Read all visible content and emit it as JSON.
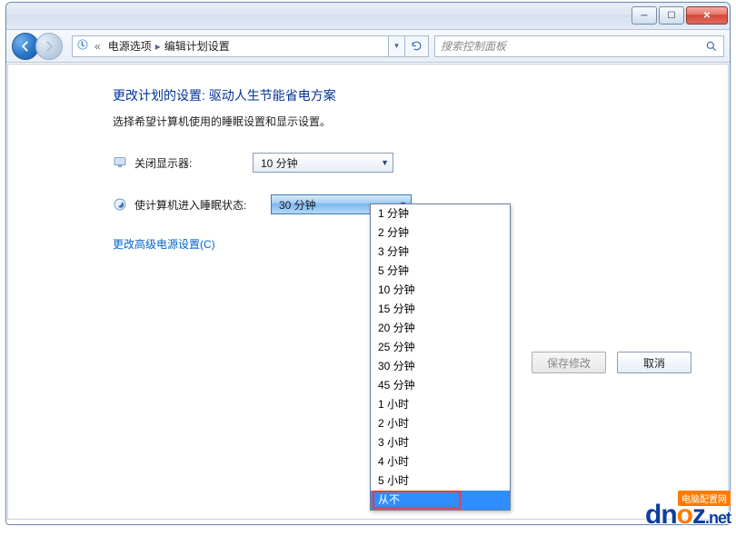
{
  "window_buttons": {
    "min": "─",
    "max": "☐",
    "close": "✕"
  },
  "breadcrumb": {
    "icon_label": "power-options-icon",
    "prefix": "«",
    "seg1": "电源选项",
    "seg2": "编辑计划设置"
  },
  "search": {
    "placeholder": "搜索控制面板"
  },
  "heading": "更改计划的设置: 驱动人生节能省电方案",
  "subtext": "选择希望计算机使用的睡眠设置和显示设置。",
  "rows": {
    "display": {
      "label": "关闭显示器:",
      "value": "10 分钟"
    },
    "sleep": {
      "label": "使计算机进入睡眠状态:",
      "value": "30 分钟"
    }
  },
  "advanced_link": "更改高级电源设置(C)",
  "buttons": {
    "save": "保存修改",
    "cancel": "取消"
  },
  "options": [
    "1 分钟",
    "2 分钟",
    "3 分钟",
    "5 分钟",
    "10 分钟",
    "15 分钟",
    "20 分钟",
    "25 分钟",
    "30 分钟",
    "45 分钟",
    "1 小时",
    "2 小时",
    "3 小时",
    "4 小时",
    "5 小时",
    "从不"
  ],
  "selected_option_index": 15,
  "watermark": {
    "text1": "dn",
    "text2_o": "o",
    "text3": "z",
    "net": ".net",
    "tag": "电脑配置网"
  }
}
